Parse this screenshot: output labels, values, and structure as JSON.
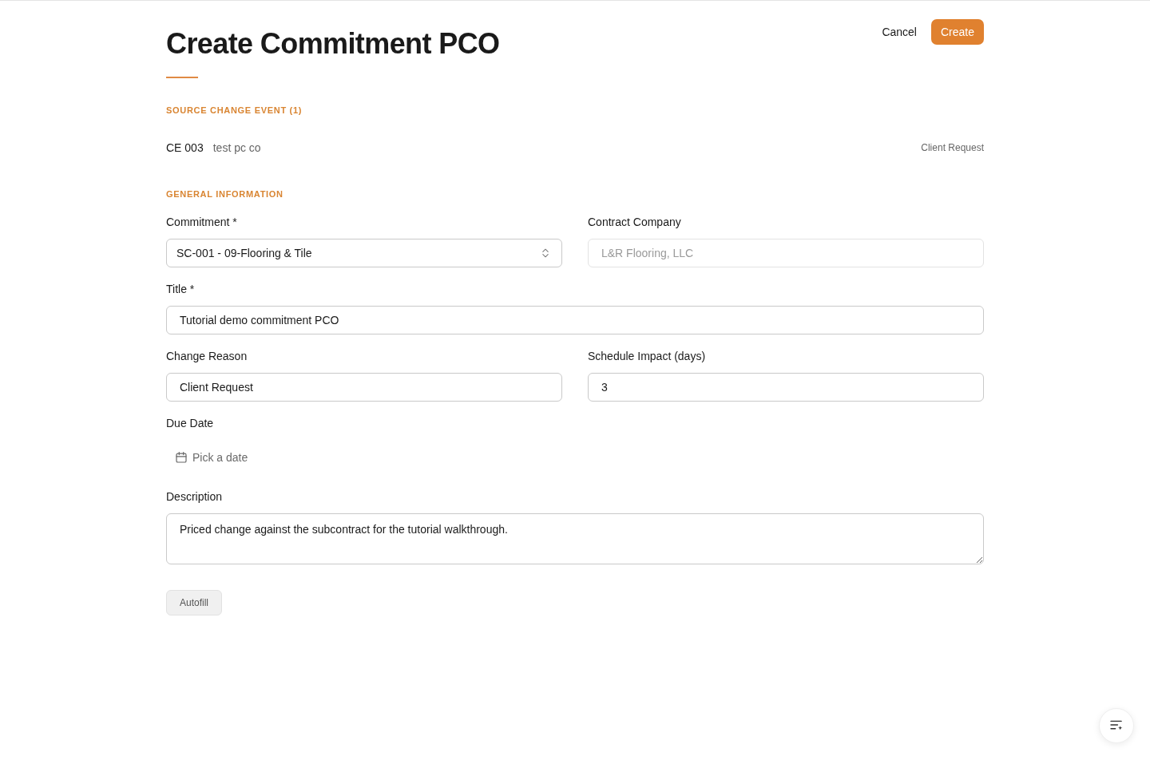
{
  "header": {
    "title": "Create Commitment PCO",
    "actions": [
      {
        "label": "Cancel",
        "kind": "secondary"
      },
      {
        "label": "Create",
        "kind": "primary"
      }
    ]
  },
  "source_section": {
    "heading": "SOURCE CHANGE EVENT (1)",
    "event": {
      "number": "CE 003",
      "name": "test pc co",
      "reason": "Client Request"
    }
  },
  "general_section": {
    "heading": "GENERAL INFORMATION",
    "rows": [
      [
        {
          "label": "Commitment *",
          "kind": "select",
          "value": "SC-001 - 09-Flooring & Tile",
          "disabled": false
        },
        {
          "label": "Contract Company",
          "kind": "text",
          "value": "L&R Flooring, LLC",
          "disabled": true
        }
      ],
      [
        {
          "label": "Title *",
          "kind": "text",
          "value": "Tutorial demo commitment PCO",
          "disabled": false
        }
      ],
      [
        {
          "label": "Change Reason",
          "kind": "text",
          "value": "Client Request",
          "disabled": false
        },
        {
          "label": "Schedule Impact (days)",
          "kind": "text",
          "value": "3",
          "disabled": false
        }
      ],
      [
        {
          "label": "Due Date",
          "kind": "date",
          "placeholder": "Pick a date",
          "disabled": false
        }
      ],
      [
        {
          "label": "Description",
          "kind": "textarea",
          "value": "Priced change against the subcontract for the tutorial walkthrough.",
          "disabled": false
        }
      ]
    ]
  },
  "autofill_button": {
    "label": "Autofill"
  }
}
